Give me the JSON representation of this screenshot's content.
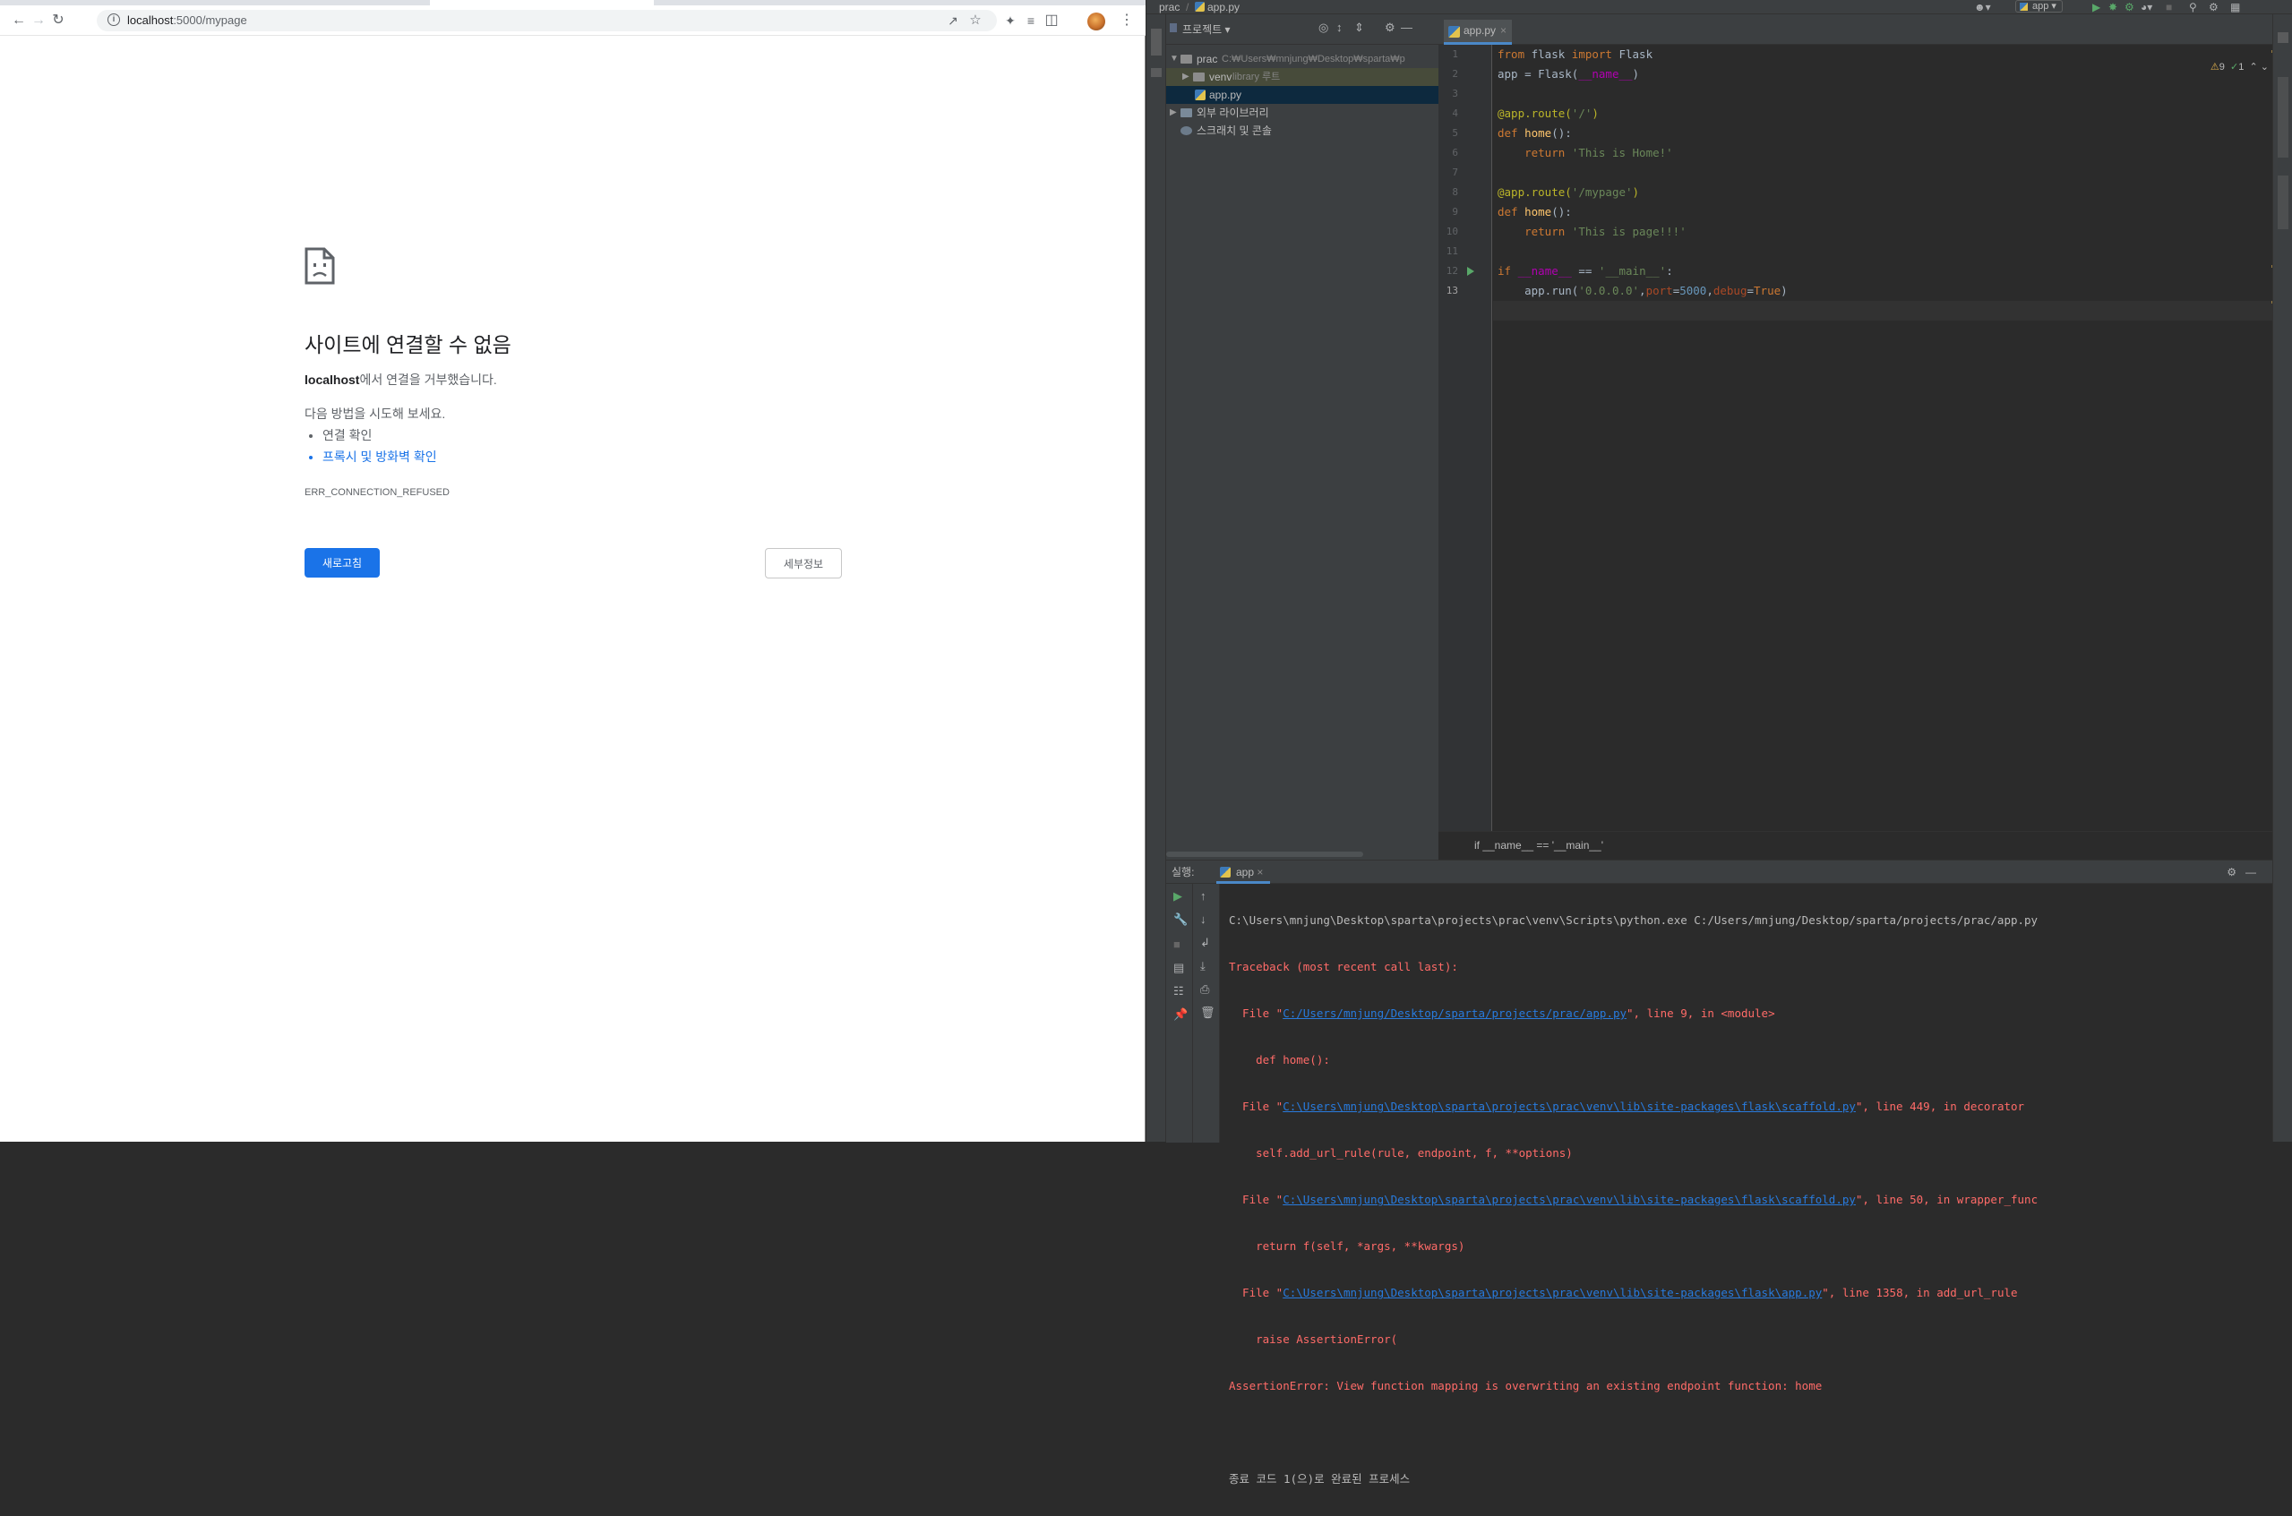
{
  "browser": {
    "url_host": "localhost",
    "url_rest": ":5000/mypage",
    "error": {
      "title": "사이트에 연결할 수 없음",
      "host": "localhost",
      "message_suffix": "에서 연결을 거부했습니다.",
      "suggest_label": "다음 방법을 시도해 보세요.",
      "suggestions": [
        "연결 확인",
        "프록시 및 방화벽 확인"
      ],
      "code": "ERR_CONNECTION_REFUSED",
      "reload_label": "새로고침",
      "details_label": "세부정보"
    }
  },
  "ide": {
    "breadcrumb": [
      "prac",
      "app.py"
    ],
    "run_config": "app",
    "project_panel": {
      "title": "프로젝트",
      "tree": [
        {
          "label": "prac",
          "hint": "C:₩Users₩mnjung₩Desktop₩sparta₩p"
        },
        {
          "label": "venv",
          "hint": "library 루트"
        },
        {
          "label": "app.py",
          "hint": ""
        },
        {
          "label": "외부 라이브러리",
          "hint": ""
        },
        {
          "label": "스크래치 및 콘솔",
          "hint": ""
        }
      ]
    },
    "editor": {
      "tab": "app.py",
      "inspections": {
        "warnings": "9",
        "ok": "1"
      },
      "line_numbers": [
        "1",
        "2",
        "3",
        "4",
        "5",
        "6",
        "7",
        "8",
        "9",
        "10",
        "11",
        "12",
        "13"
      ],
      "breadcrumb": "if __name__ == '__main__'"
    },
    "run": {
      "title": "실행:",
      "tab": "app",
      "console": [
        "C:\\Users\\mnjung\\Desktop\\sparta\\projects\\prac\\venv\\Scripts\\python.exe C:/Users/mnjung/Desktop/sparta/projects/prac/app.py",
        "Traceback (most recent call last):",
        "  File \"",
        "C:/Users/mnjung/Desktop/sparta/projects/prac/app.py",
        "\", line 9, in <module>",
        "    def home():",
        "C:\\Users\\mnjung\\Desktop\\sparta\\projects\\prac\\venv\\lib\\site-packages\\flask\\scaffold.py",
        "\", line 449, in decorator",
        "    self.add_url_rule(rule, endpoint, f, **options)",
        "\", line 50, in wrapper_func",
        "    return f(self, *args, **kwargs)",
        "C:\\Users\\mnjung\\Desktop\\sparta\\projects\\prac\\venv\\lib\\site-packages\\flask\\app.py",
        "\", line 1358, in add_url_rule",
        "    raise AssertionError(",
        "AssertionError: View function mapping is overwriting an existing endpoint function: home",
        "종료 코드 1(으)로 완료된 프로세스"
      ]
    }
  }
}
